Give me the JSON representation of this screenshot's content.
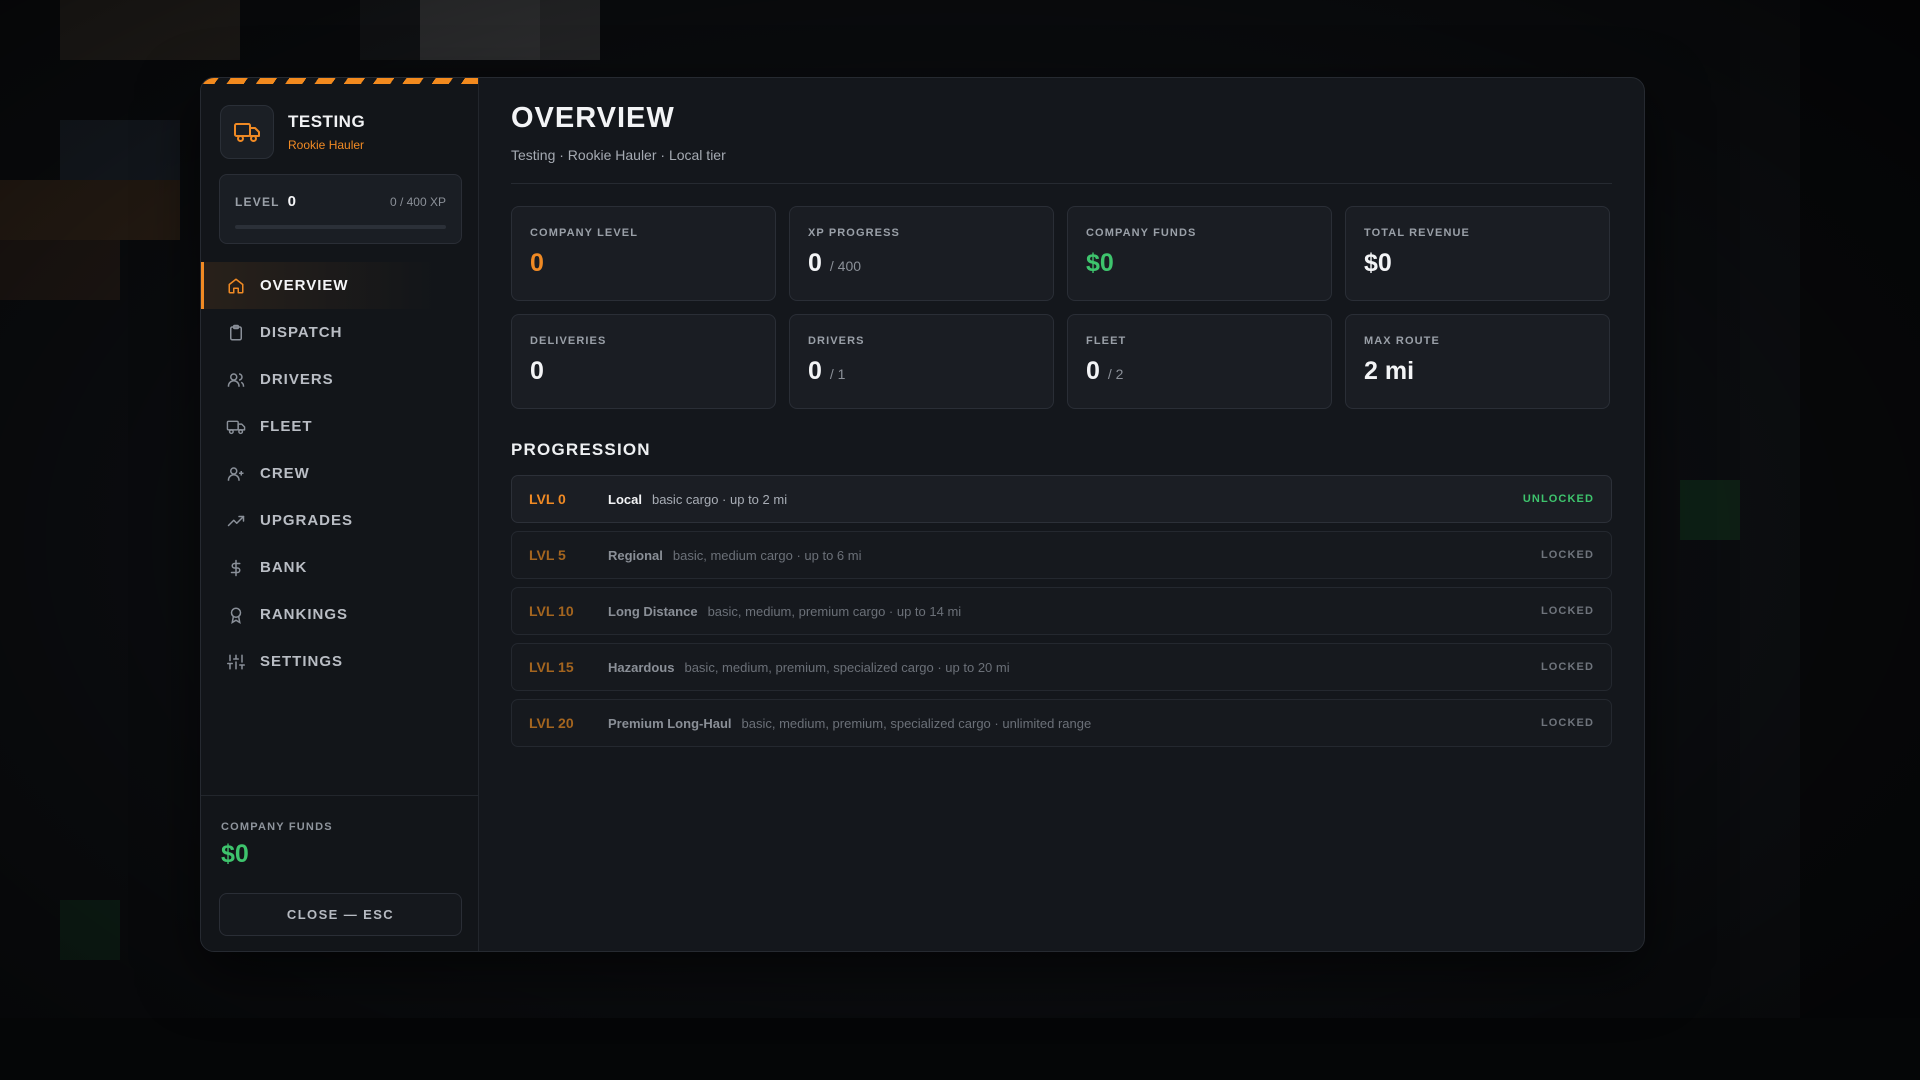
{
  "colors": {
    "accent": "#f08a24",
    "success": "#3ec46d",
    "panel": "#14171c"
  },
  "company": {
    "name": "TESTING",
    "rank": "Rookie Hauler"
  },
  "level_card": {
    "label": "LEVEL",
    "level": "0",
    "xp_text": "0 / 400 XP",
    "progress_fraction": 0.0
  },
  "nav": {
    "items": [
      {
        "label": "OVERVIEW",
        "icon": "home-icon",
        "active": true
      },
      {
        "label": "DISPATCH",
        "icon": "clipboard-icon",
        "active": false
      },
      {
        "label": "DRIVERS",
        "icon": "users-icon",
        "active": false
      },
      {
        "label": "FLEET",
        "icon": "truck-icon",
        "active": false
      },
      {
        "label": "CREW",
        "icon": "user-plus-icon",
        "active": false
      },
      {
        "label": "UPGRADES",
        "icon": "trending-up-icon",
        "active": false
      },
      {
        "label": "BANK",
        "icon": "dollar-icon",
        "active": false
      },
      {
        "label": "RANKINGS",
        "icon": "award-icon",
        "active": false
      },
      {
        "label": "SETTINGS",
        "icon": "sliders-icon",
        "active": false
      }
    ]
  },
  "sidebar_footer": {
    "funds_label": "COMPANY FUNDS",
    "funds_value": "$0",
    "close_label": "CLOSE — ESC"
  },
  "header": {
    "title": "OVERVIEW",
    "subtitle": "Testing · Rookie Hauler · Local tier"
  },
  "stats": [
    {
      "label": "COMPANY LEVEL",
      "value": "0",
      "suffix": "",
      "tone": "orange"
    },
    {
      "label": "XP PROGRESS",
      "value": "0",
      "suffix": "/ 400",
      "tone": "default"
    },
    {
      "label": "COMPANY FUNDS",
      "value": "$0",
      "suffix": "",
      "tone": "green"
    },
    {
      "label": "TOTAL REVENUE",
      "value": "$0",
      "suffix": "",
      "tone": "default"
    },
    {
      "label": "DELIVERIES",
      "value": "0",
      "suffix": "",
      "tone": "default"
    },
    {
      "label": "DRIVERS",
      "value": "0",
      "suffix": "/ 1",
      "tone": "default"
    },
    {
      "label": "FLEET",
      "value": "0",
      "suffix": "/ 2",
      "tone": "default"
    },
    {
      "label": "MAX ROUTE",
      "value": "2 mi",
      "suffix": "",
      "tone": "default"
    }
  ],
  "progression": {
    "title": "PROGRESSION",
    "tiers": [
      {
        "level": "LVL 0",
        "name": "Local",
        "desc": "basic cargo · up to 2 mi",
        "status": "UNLOCKED",
        "unlocked": true
      },
      {
        "level": "LVL 5",
        "name": "Regional",
        "desc": "basic, medium cargo · up to 6 mi",
        "status": "LOCKED",
        "unlocked": false
      },
      {
        "level": "LVL 10",
        "name": "Long Distance",
        "desc": "basic, medium, premium cargo · up to 14 mi",
        "status": "LOCKED",
        "unlocked": false
      },
      {
        "level": "LVL 15",
        "name": "Hazardous",
        "desc": "basic, medium, premium, specialized cargo · up to 20 mi",
        "status": "LOCKED",
        "unlocked": false
      },
      {
        "level": "LVL 20",
        "name": "Premium Long-Haul",
        "desc": "basic, medium, premium, specialized cargo · unlimited range",
        "status": "LOCKED",
        "unlocked": false
      }
    ]
  }
}
